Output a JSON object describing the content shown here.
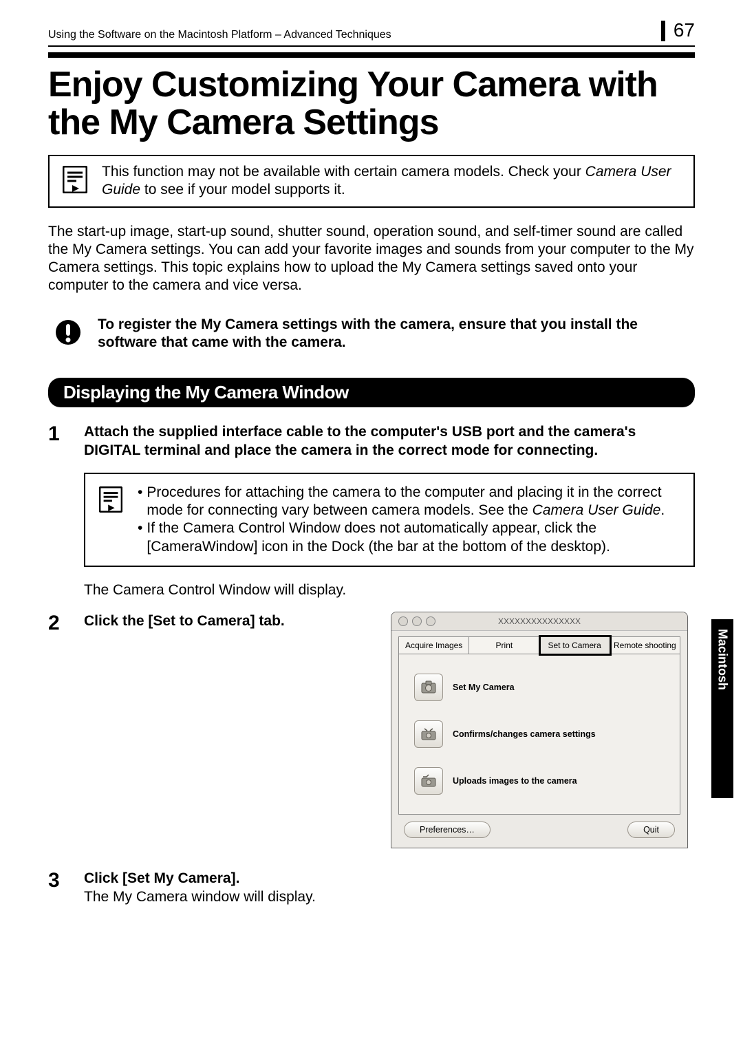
{
  "header": {
    "breadcrumb": "Using the Software on the Macintosh Platform – Advanced Techniques",
    "page_number": "67"
  },
  "title": "Enjoy Customizing Your Camera with the My Camera Settings",
  "note1_a": "This function may not be available with certain camera models. Check your ",
  "note1_b": "Camera User Guide",
  "note1_c": " to see if your model supports it.",
  "intro": "The start-up image, start-up sound, shutter sound, operation sound, and self-timer sound are called the My Camera settings. You can add your favorite images and sounds from your computer to the My Camera settings. This topic explains how to upload the My Camera settings saved onto your computer to the camera and vice versa.",
  "warn": "To register the My Camera settings with the camera, ensure that you install the software that came with the camera.",
  "section_heading": "Displaying the My Camera Window",
  "step1": {
    "num": "1",
    "text": "Attach the supplied interface cable to the computer's USB port and the camera's DIGITAL terminal and place the camera in the correct mode for connecting."
  },
  "sub_note": {
    "b1a": "Procedures for attaching the camera to the computer and placing it in the correct mode for connecting vary between camera models. See the ",
    "b1b": "Camera User Guide",
    "b1c": ".",
    "b2": "If the Camera Control Window does not automatically appear, click the [CameraWindow] icon in the Dock (the bar at the bottom of the desktop)."
  },
  "step1_result": "The Camera Control Window will display.",
  "step2": {
    "num": "2",
    "text": "Click the [Set to Camera] tab."
  },
  "mac_window": {
    "title": "XXXXXXXXXXXXXXX",
    "tabs": [
      "Acquire Images",
      "Print",
      "Set to Camera",
      "Remote shooting"
    ],
    "items": [
      "Set My Camera",
      "Confirms/changes camera settings",
      "Uploads images to the camera"
    ],
    "prefs": "Preferences…",
    "quit": "Quit"
  },
  "step3": {
    "num": "3",
    "bold": "Click [Set My Camera].",
    "result": "The My Camera window will display."
  },
  "side_tab": "Macintosh"
}
